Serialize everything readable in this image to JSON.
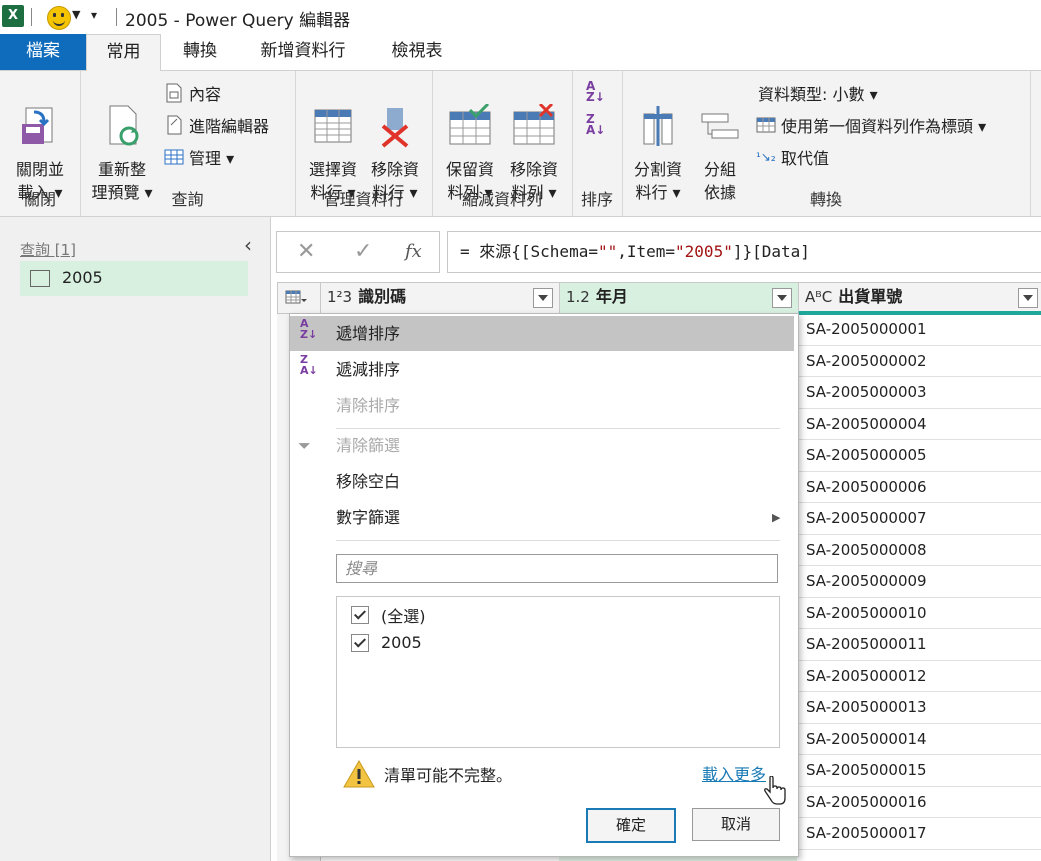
{
  "window": {
    "title": "2005 - Power Query 編輯器",
    "app_icon": "X"
  },
  "tabs": [
    {
      "label": "檔案"
    },
    {
      "label": "常用"
    },
    {
      "label": "轉換"
    },
    {
      "label": "新增資料行"
    },
    {
      "label": "檢視表"
    }
  ],
  "ribbon": {
    "close_group": {
      "label": "關閉",
      "close_load": "關閉並\n載入 ▾"
    },
    "query_group": {
      "label": "查詢",
      "refresh": "重新整\n理預覽 ▾",
      "properties": "內容",
      "advanced_editor": "進階編輯器",
      "manage": "管理 ▾"
    },
    "manage_cols_group": {
      "label": "管理資料行",
      "choose_cols": "選擇資\n料行 ▾",
      "remove_cols": "移除資\n料行 ▾"
    },
    "reduce_rows_group": {
      "label": "縮減資料列",
      "keep_rows": "保留資\n料列 ▾",
      "remove_rows": "移除資\n料列 ▾"
    },
    "sort_group": {
      "label": "排序"
    },
    "transform_group": {
      "label": "轉換",
      "split_col": "分割資\n料行 ▾",
      "group_by": "分組\n依據",
      "data_type": "資料類型: 小數 ▾",
      "use_first_row": "使用第一個資料列作為標頭 ▾",
      "replace_values": "取代值"
    }
  },
  "left_pane": {
    "header": "查詢 [1]",
    "items": [
      {
        "label": "2005"
      }
    ]
  },
  "formula_bar": {
    "cancel": "✕",
    "confirm": "✓",
    "fx": "fx",
    "prefix": "= 來源{[Schema=",
    "s1": "\"\"",
    "mid": ",Item=",
    "s2": "\"2005\"",
    "suffix": "]}[Data]"
  },
  "columns": [
    {
      "type": "1²3",
      "name": "識別碼"
    },
    {
      "type": "1.2",
      "name": "年月"
    },
    {
      "type": "AᴮC",
      "name": "出貨單號"
    }
  ],
  "rows": [
    "SA-2005000001",
    "SA-2005000002",
    "SA-2005000003",
    "SA-2005000004",
    "SA-2005000005",
    "SA-2005000006",
    "SA-2005000007",
    "SA-2005000008",
    "SA-2005000009",
    "SA-2005000010",
    "SA-2005000011",
    "SA-2005000012",
    "SA-2005000013",
    "SA-2005000014",
    "SA-2005000015",
    "SA-2005000016",
    "SA-2005000017"
  ],
  "menu": {
    "sort_asc": "遞增排序",
    "sort_desc": "遞減排序",
    "clear_sort": "清除排序",
    "clear_filter": "清除篩選",
    "remove_empty": "移除空白",
    "number_filter": "數字篩選",
    "search_placeholder": "搜尋",
    "options": [
      {
        "label": "(全選)",
        "checked": true
      },
      {
        "label": "2005",
        "checked": true
      }
    ],
    "warning": "清單可能不完整。",
    "load_more": "載入更多",
    "ok": "確定",
    "cancel": "取消"
  },
  "colors": {
    "file_tab": "#0f6cbd",
    "selected_query": "#d8f0e0",
    "accent_teal": "#1fa89a",
    "link": "#1a7ab5"
  }
}
